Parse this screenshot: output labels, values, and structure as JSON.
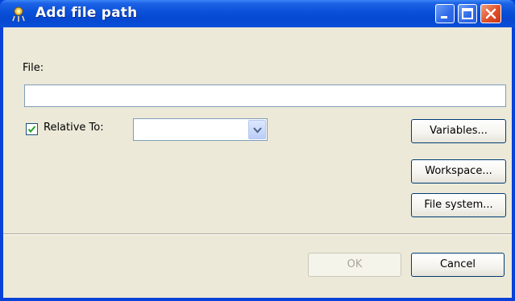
{
  "window": {
    "title": "Add file path",
    "app_icon": "gear-sparkle-icon",
    "controls": [
      "minimize-icon",
      "maximize-icon",
      "close-icon"
    ]
  },
  "form": {
    "file_label": "File:",
    "file_value": "",
    "relative_checkbox": {
      "label": "Relative To:",
      "checked": true
    },
    "relative_combo_value": ""
  },
  "buttons": {
    "variables": "Variables...",
    "workspace": "Workspace...",
    "file_system": "File system...",
    "ok": "OK",
    "cancel": "Cancel"
  },
  "colors": {
    "titlebar": "#0a50d8",
    "dialog_background": "#ece9d8",
    "close_button": "#e0502a"
  }
}
